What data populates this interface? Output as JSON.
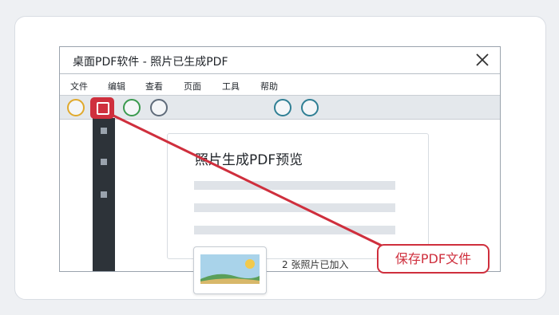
{
  "window": {
    "title": "桌面PDF软件 - 照片已生成PDF",
    "close_icon": "close-icon"
  },
  "menu": [
    "文件",
    "编辑",
    "查看",
    "页面",
    "工具",
    "帮助"
  ],
  "toolbar": {
    "circle_colors": [
      "#e0a92c",
      "#3a9a4e",
      "#5f6b7a",
      "#2f7f94",
      "#2f7f94"
    ],
    "highlighted_tool_icon": "save-icon"
  },
  "preview": {
    "title": "照片生成PDF预览"
  },
  "status": {
    "text": "2 张照片已加入"
  },
  "thumbnail": {
    "icon": "photo-thumbnail-icon"
  },
  "callout": {
    "label": "保存PDF文件",
    "color": "#cf2f3d"
  }
}
